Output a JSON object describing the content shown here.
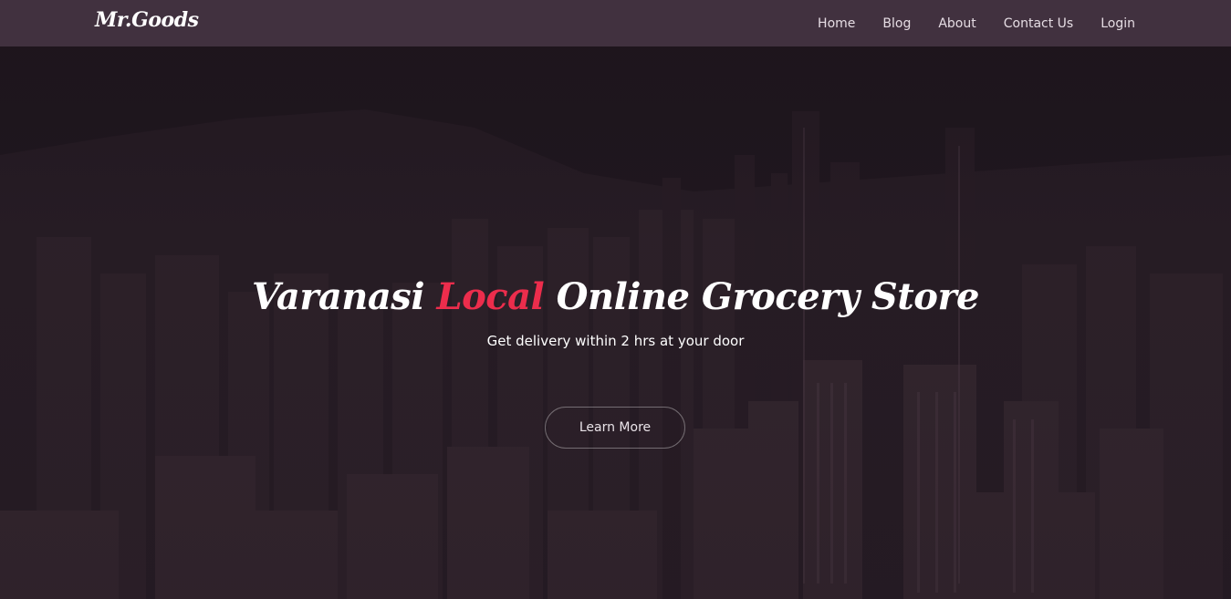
{
  "navbar": {
    "brand": "Mr.Goods",
    "links": [
      {
        "label": "Home"
      },
      {
        "label": "Blog"
      },
      {
        "label": "About"
      },
      {
        "label": "Contact Us"
      },
      {
        "label": "Login"
      }
    ]
  },
  "hero": {
    "headline_part1": "Varanasi ",
    "headline_accent": "Local",
    "headline_part2": " Online Grocery Store",
    "subheadline": "Get delivery within 2 hrs at your door",
    "cta_label": "Learn More"
  },
  "colors": {
    "navbar_bg": "#41313f",
    "accent": "#ec2d4c",
    "hero_overlay": "#1d141c"
  }
}
